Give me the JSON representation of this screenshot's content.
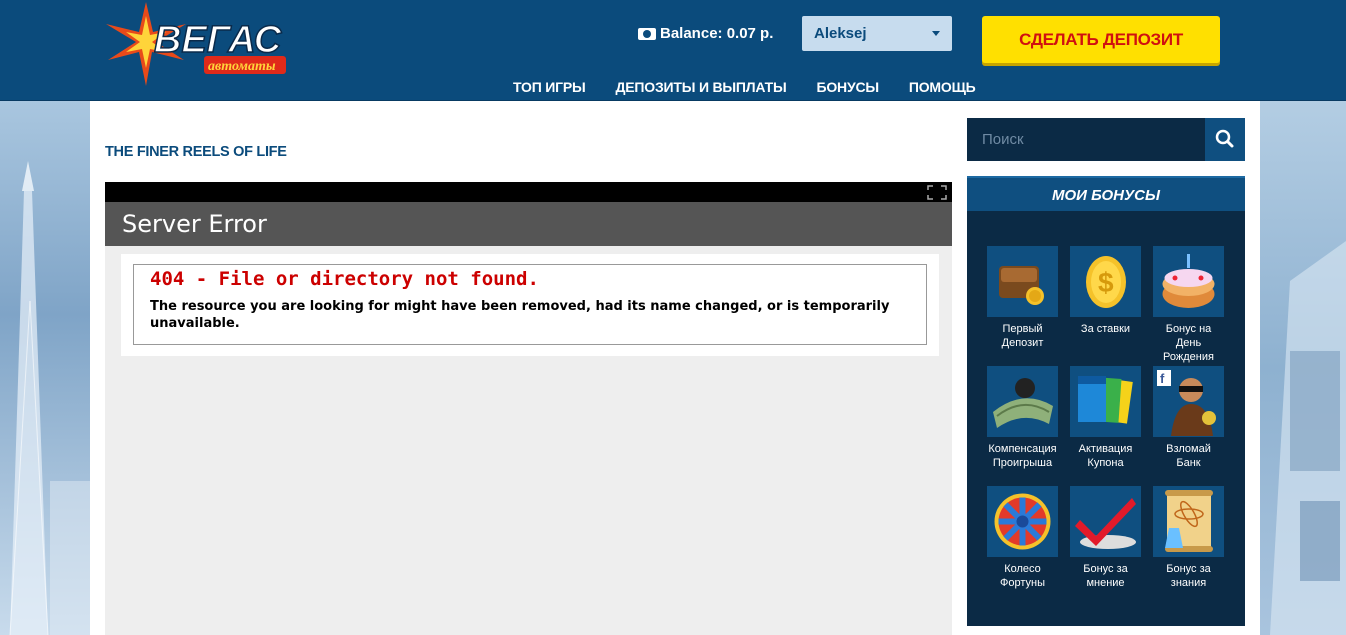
{
  "header": {
    "logo_main": "ВЕГАС",
    "logo_sub": "автоматы",
    "balance_label": "Balance: 0.07 р.",
    "user": "Aleksej",
    "deposit_button": "СДЕЛАТЬ ДЕПОЗИТ",
    "nav": [
      "ТОП ИГРЫ",
      "ДЕПОЗИТЫ И ВЫПЛАТЫ",
      "БОНУСЫ",
      "ПОМОЩЬ"
    ]
  },
  "main": {
    "tagline": "THE FINER REELS OF LIFE",
    "error_header": "Server Error",
    "error_title": "404 - File or directory not found.",
    "error_text": "The resource you are looking for might have been removed, had its name changed, or is temporarily unavailable."
  },
  "sidebar": {
    "search_placeholder": "Поиск",
    "bonuses_title": "МОИ БОНУСЫ",
    "bonuses": [
      {
        "label": "Первый Депозит",
        "icon": "wallet-icon"
      },
      {
        "label": "За ставки",
        "icon": "coins-icon"
      },
      {
        "label": "Бонус на День Рождения",
        "icon": "cake-icon"
      },
      {
        "label": "Компенсация Проигрыша",
        "icon": "cash-fan-icon"
      },
      {
        "label": "Активация Купона",
        "icon": "coupon-icon"
      },
      {
        "label": "Взломай Банк",
        "icon": "robber-icon"
      },
      {
        "label": "Колесо Фортуны",
        "icon": "wheel-icon"
      },
      {
        "label": "Бонус за мнение",
        "icon": "checkmark-icon"
      },
      {
        "label": "Бонус за знания",
        "icon": "scroll-atom-icon"
      }
    ]
  },
  "colors": {
    "header_bg": "#0b4b7c",
    "deposit_bg": "#ffe000",
    "deposit_text": "#d01010",
    "error_red": "#cc0000",
    "sidebar_bg": "#0b2a45"
  }
}
